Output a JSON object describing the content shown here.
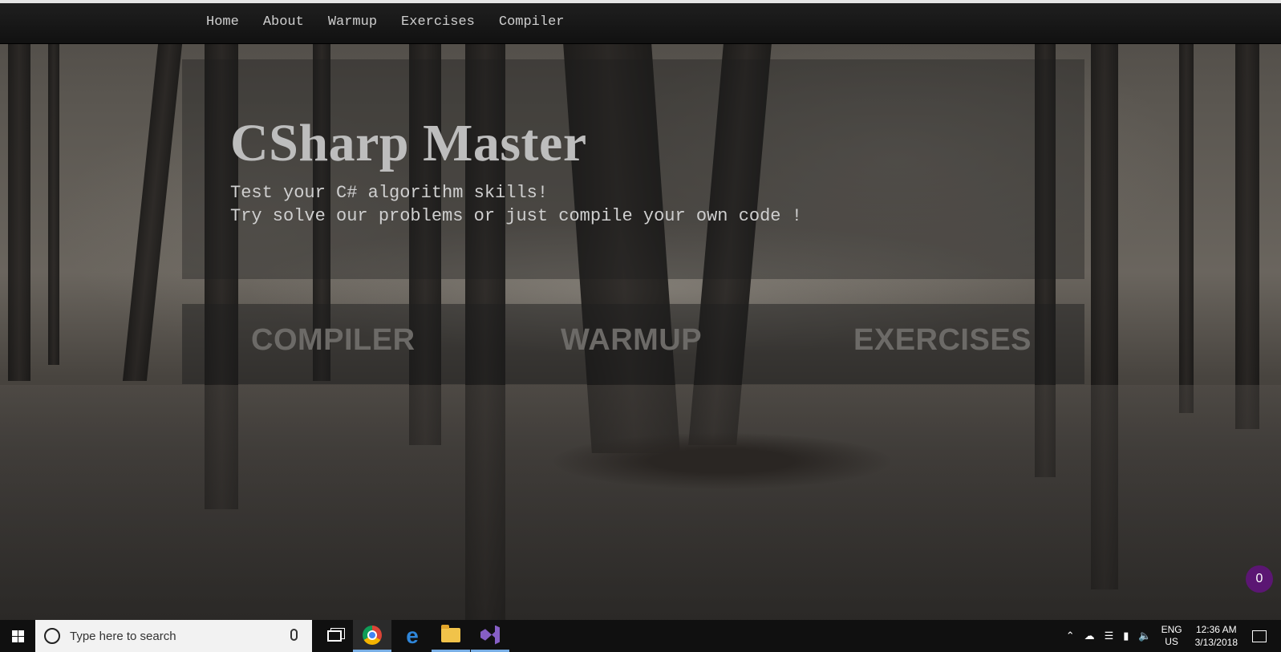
{
  "nav": {
    "items": [
      "Home",
      "About",
      "Warmup",
      "Exercises",
      "Compiler"
    ]
  },
  "hero": {
    "title": "CSharp Master",
    "line1": "Test your C# algorithm skills!",
    "line2": "Try solve our problems or just compile your own code !"
  },
  "actions": {
    "compiler": "COMPILER",
    "warmup": "WARMUP",
    "exercises": "EXERCISES"
  },
  "badge": {
    "count": "0"
  },
  "taskbar": {
    "search_placeholder": "Type here to search",
    "lang_line1": "ENG",
    "lang_line2": "US",
    "time": "12:36 AM",
    "date": "3/13/2018"
  },
  "icons": {
    "start": "windows-logo-icon",
    "search": "search-icon",
    "mic": "microphone-icon",
    "taskview": "task-view-icon",
    "chrome": "chrome-icon",
    "edge": "edge-icon",
    "explorer": "folder-icon",
    "visual_studio": "visual-studio-icon",
    "notification": "notification-icon"
  }
}
